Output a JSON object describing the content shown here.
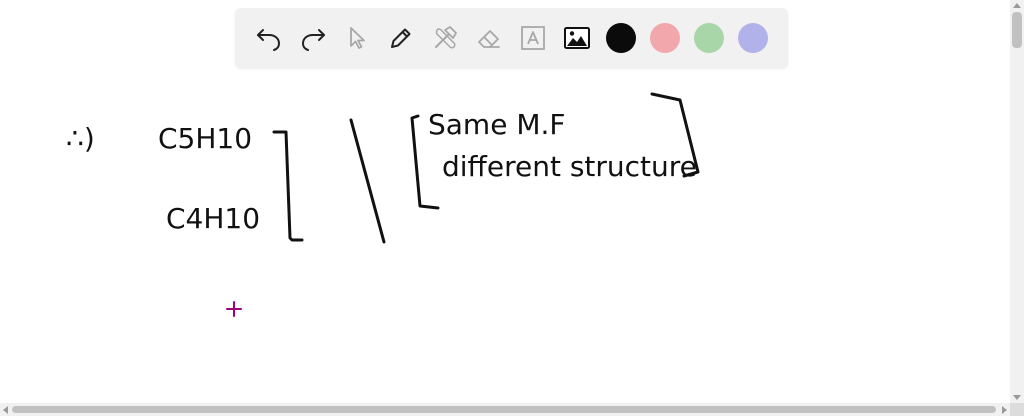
{
  "toolbar": {
    "tools": [
      {
        "name": "undo",
        "icon": "undo-icon",
        "enabled": true
      },
      {
        "name": "redo",
        "icon": "redo-icon",
        "enabled": true
      },
      {
        "name": "select",
        "icon": "select-arrow-icon",
        "enabled": false
      },
      {
        "name": "pen",
        "icon": "pen-icon",
        "enabled": true
      },
      {
        "name": "tools",
        "icon": "hammer-wrench-icon",
        "enabled": false
      },
      {
        "name": "eraser",
        "icon": "eraser-icon",
        "enabled": false
      },
      {
        "name": "text",
        "icon": "text-box-icon",
        "enabled": false
      },
      {
        "name": "image",
        "icon": "image-icon",
        "enabled": true
      }
    ],
    "colors": {
      "black": "#0b0b0b",
      "red": "#f2a7ad",
      "green": "#a9d6a9",
      "purple": "#b2b2ea"
    }
  },
  "canvas": {
    "bullet": "∴)",
    "formula_1": "C5H10",
    "formula_2": "C4H10",
    "note_line_1": "Same M.F",
    "note_line_2": "different structure",
    "ink_color": "#111111",
    "cursor_color": "#a0007a"
  }
}
